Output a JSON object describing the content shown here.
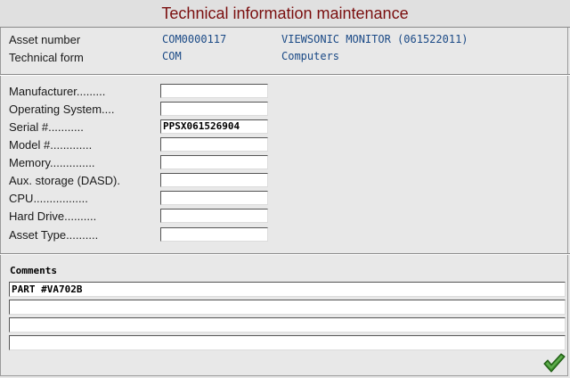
{
  "window": {
    "title": "Technical information maintenance"
  },
  "header": {
    "asset_number_label": "Asset number",
    "asset_number_value": "COM0000117",
    "asset_description": "VIEWSONIC MONITOR (061522011)",
    "technical_form_label": "Technical form",
    "technical_form_code": "COM",
    "technical_form_description": "Computers"
  },
  "fields": [
    {
      "label": "Manufacturer.........",
      "value": ""
    },
    {
      "label": "Operating System....",
      "value": ""
    },
    {
      "label": "Serial #...........",
      "value": "PPSX061526904"
    },
    {
      "label": "Model #.............",
      "value": ""
    },
    {
      "label": "Memory..............",
      "value": ""
    },
    {
      "label": "Aux. storage (DASD).",
      "value": ""
    },
    {
      "label": "CPU.................",
      "value": ""
    },
    {
      "label": "Hard Drive..........",
      "value": ""
    },
    {
      "label": "Asset Type..........",
      "value": ""
    }
  ],
  "comments": {
    "title": "Comments",
    "lines": [
      "PART #VA702B",
      "",
      "",
      ""
    ]
  },
  "actions": {
    "confirm_icon": "checkmark-icon",
    "confirm_color": "#3a8a2a"
  },
  "colors": {
    "title": "#7a0e0e",
    "value_text": "#1b4a86",
    "background": "#e8e8e8"
  }
}
